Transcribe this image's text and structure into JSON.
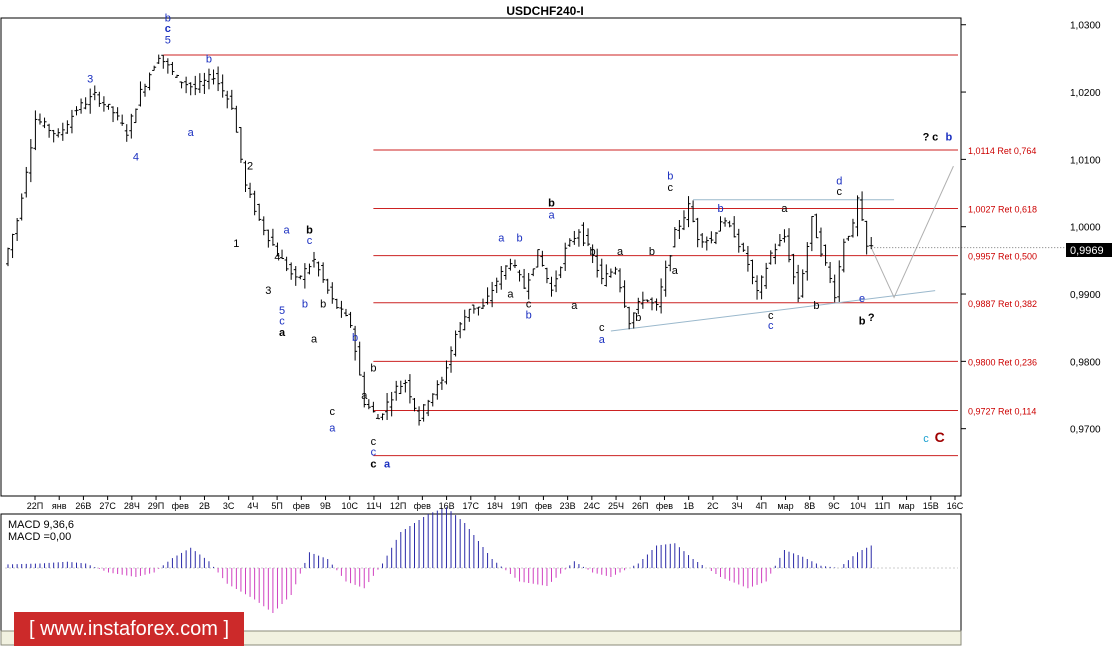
{
  "chart_data": {
    "type": "candlestick",
    "title": "USDCHF240-I",
    "current_price": "0,9969",
    "y_axis": {
      "min": 0.96,
      "max": 1.031,
      "ticks": [
        "1,0300",
        "1,0200",
        "1,0100",
        "1,0000",
        "0,9900",
        "0,9800",
        "0,9700"
      ],
      "tick_values": [
        1.03,
        1.02,
        1.01,
        1.0,
        0.99,
        0.98,
        0.97
      ]
    },
    "x_tick_labels": [
      "22П",
      "янв",
      "26В",
      "27С",
      "28Ч",
      "29П",
      "фев",
      "2В",
      "3С",
      "4Ч",
      "5П",
      "фев",
      "9В",
      "10С",
      "11Ч",
      "12П",
      "фев",
      "16В",
      "17С",
      "18Ч",
      "19П",
      "фев",
      "23В",
      "24С",
      "25Ч",
      "26П",
      "фев",
      "1В",
      "2С",
      "3Ч",
      "4П",
      "мар",
      "8В",
      "9С",
      "10Ч",
      "11П",
      "мар",
      "15В",
      "16С"
    ],
    "price_series_waypoints": [
      [
        0,
        0.9945
      ],
      [
        3,
        1.001
      ],
      [
        7,
        1.016
      ],
      [
        12,
        1.0135
      ],
      [
        16,
        1.0175
      ],
      [
        20,
        1.0195
      ],
      [
        24,
        1.017
      ],
      [
        27,
        1.014
      ],
      [
        30,
        1.02
      ],
      [
        34,
        1.0255
      ],
      [
        38,
        1.022
      ],
      [
        42,
        1.0205
      ],
      [
        46,
        1.0225
      ],
      [
        50,
        1.018
      ],
      [
        53,
        1.006
      ],
      [
        56,
        1.001
      ],
      [
        60,
        0.996
      ],
      [
        64,
        0.992
      ],
      [
        68,
        0.995
      ],
      [
        72,
        0.989
      ],
      [
        76,
        0.9855
      ],
      [
        79,
        0.974
      ],
      [
        82,
        0.9715
      ],
      [
        86,
        0.976
      ],
      [
        88,
        0.977
      ],
      [
        91,
        0.9715
      ],
      [
        93,
        0.9745
      ],
      [
        96,
        0.977
      ],
      [
        99,
        0.984
      ],
      [
        102,
        0.988
      ],
      [
        105,
        0.988
      ],
      [
        108,
        0.992
      ],
      [
        111,
        0.995
      ],
      [
        114,
        0.991
      ],
      [
        117,
        0.996
      ],
      [
        120,
        0.9905
      ],
      [
        123,
        0.9965
      ],
      [
        126,
        0.9995
      ],
      [
        129,
        0.9955
      ],
      [
        131,
        0.992
      ],
      [
        134,
        0.994
      ],
      [
        137,
        0.986
      ],
      [
        140,
        0.9895
      ],
      [
        143,
        0.988
      ],
      [
        147,
        0.999
      ],
      [
        150,
        1.003
      ],
      [
        152,
        0.9985
      ],
      [
        155,
        0.998
      ],
      [
        157,
        1.001
      ],
      [
        160,
        0.999
      ],
      [
        163,
        0.9945
      ],
      [
        165,
        0.99
      ],
      [
        168,
        0.996
      ],
      [
        171,
        0.9985
      ],
      [
        174,
        0.9895
      ],
      [
        177,
        1.001
      ],
      [
        179,
        0.9965
      ],
      [
        182,
        0.99
      ],
      [
        184,
        0.998
      ],
      [
        186,
        1.0
      ],
      [
        187,
        1.004
      ],
      [
        189,
        0.9969
      ]
    ],
    "fib_levels": [
      {
        "value": 1.0255,
        "label": ""
      },
      {
        "value": 1.0114,
        "label": "1,0114 Ret 0,764"
      },
      {
        "value": 1.0027,
        "label": "1,0027 Ret 0,618"
      },
      {
        "value": 0.9957,
        "label": "0,9957 Ret 0,500"
      },
      {
        "value": 0.9887,
        "label": "0,9887 Ret 0,382"
      },
      {
        "value": 0.98,
        "label": "0,9800 Ret 0,236"
      },
      {
        "value": 0.9727,
        "label": "0,9727 Ret 0,114"
      },
      {
        "value": 0.966,
        "label": ""
      }
    ],
    "trendlines": [
      {
        "from": [
          132,
          0.9845
        ],
        "to": [
          203,
          0.9905
        ]
      },
      {
        "from": [
          150,
          1.004
        ],
        "to": [
          194,
          1.004
        ]
      }
    ],
    "projection": [
      [
        189,
        0.9969
      ],
      [
        194,
        0.9895
      ],
      [
        207,
        1.009
      ]
    ],
    "wave_labels": [
      {
        "text": "b",
        "i": 35,
        "v": 1.0305,
        "color": "#1a2fc0",
        "bold": false
      },
      {
        "text": "c",
        "i": 35,
        "v": 1.0289,
        "color": "#1a2fc0",
        "bold": true
      },
      {
        "text": "5",
        "i": 35,
        "v": 1.0272,
        "color": "#1a2fc0",
        "bold": false
      },
      {
        "text": "b",
        "i": 44,
        "v": 1.0244,
        "color": "#1a2fc0",
        "bold": false
      },
      {
        "text": "3",
        "i": 18,
        "v": 1.0214,
        "color": "#1a2fc0",
        "bold": false
      },
      {
        "text": "4",
        "i": 28,
        "v": 1.0098,
        "color": "#1a2fc0",
        "bold": false
      },
      {
        "text": "a",
        "i": 40,
        "v": 1.0135,
        "color": "#1a2fc0",
        "bold": false
      },
      {
        "text": "2",
        "i": 53,
        "v": 1.0085,
        "color": "#000000",
        "bold": false
      },
      {
        "text": "1",
        "i": 50,
        "v": 0.997,
        "color": "#000000",
        "bold": false
      },
      {
        "text": "4",
        "i": 59,
        "v": 0.995,
        "color": "#000000",
        "bold": false
      },
      {
        "text": "3",
        "i": 57,
        "v": 0.99,
        "color": "#000000",
        "bold": false
      },
      {
        "text": "a",
        "i": 61,
        "v": 0.999,
        "color": "#1a2fc0",
        "bold": false
      },
      {
        "text": "b",
        "i": 66,
        "v": 0.999,
        "color": "#000000",
        "bold": true
      },
      {
        "text": "c",
        "i": 66,
        "v": 0.9974,
        "color": "#1a2fc0",
        "bold": false
      },
      {
        "text": "b",
        "i": 65,
        "v": 0.988,
        "color": "#1a2fc0",
        "bold": false
      },
      {
        "text": "5",
        "i": 60,
        "v": 0.987,
        "color": "#1a2fc0",
        "bold": false
      },
      {
        "text": "c",
        "i": 60,
        "v": 0.9855,
        "color": "#1a2fc0",
        "bold": false
      },
      {
        "text": "a",
        "i": 60,
        "v": 0.9838,
        "color": "#000000",
        "bold": true
      },
      {
        "text": "b",
        "i": 69,
        "v": 0.988,
        "color": "#000000",
        "bold": false
      },
      {
        "text": "a",
        "i": 67,
        "v": 0.9828,
        "color": "#000000",
        "bold": false
      },
      {
        "text": "b",
        "i": 76,
        "v": 0.983,
        "color": "#1a2fc0",
        "bold": false
      },
      {
        "text": "c",
        "i": 71,
        "v": 0.972,
        "color": "#000000",
        "bold": false
      },
      {
        "text": "a",
        "i": 71,
        "v": 0.9696,
        "color": "#1a2fc0",
        "bold": false
      },
      {
        "text": "b",
        "i": 80,
        "v": 0.9785,
        "color": "#000000",
        "bold": false
      },
      {
        "text": "a",
        "i": 78,
        "v": 0.9744,
        "color": "#000000",
        "bold": false
      },
      {
        "text": "c",
        "i": 80,
        "v": 0.9676,
        "color": "#000000",
        "bold": false
      },
      {
        "text": "c",
        "i": 80,
        "v": 0.966,
        "color": "#1a2fc0",
        "bold": false
      },
      {
        "text": "c",
        "i": 80,
        "v": 0.9642,
        "color": "#000000",
        "bold": true
      },
      {
        "text": "a",
        "i": 83,
        "v": 0.9642,
        "color": "#1a2fc0",
        "bold": true
      },
      {
        "text": "a",
        "i": 108,
        "v": 0.9978,
        "color": "#1a2fc0",
        "bold": false
      },
      {
        "text": "b",
        "i": 112,
        "v": 0.9978,
        "color": "#1a2fc0",
        "bold": false
      },
      {
        "text": "b",
        "i": 119,
        "v": 1.003,
        "color": "#000000",
        "bold": true
      },
      {
        "text": "a",
        "i": 119,
        "v": 1.0012,
        "color": "#1a2fc0",
        "bold": false
      },
      {
        "text": "b",
        "i": 128,
        "v": 0.9958,
        "color": "#000000",
        "bold": false
      },
      {
        "text": "a",
        "i": 134,
        "v": 0.9958,
        "color": "#000000",
        "bold": false
      },
      {
        "text": "b",
        "i": 141,
        "v": 0.9958,
        "color": "#000000",
        "bold": false
      },
      {
        "text": "a",
        "i": 110,
        "v": 0.9895,
        "color": "#000000",
        "bold": false
      },
      {
        "text": "c",
        "i": 114,
        "v": 0.988,
        "color": "#000000",
        "bold": false
      },
      {
        "text": "b",
        "i": 114,
        "v": 0.9864,
        "color": "#1a2fc0",
        "bold": false
      },
      {
        "text": "a",
        "i": 124,
        "v": 0.9878,
        "color": "#000000",
        "bold": false
      },
      {
        "text": "c",
        "i": 130,
        "v": 0.9845,
        "color": "#000000",
        "bold": false
      },
      {
        "text": "a",
        "i": 130,
        "v": 0.9827,
        "color": "#1a2fc0",
        "bold": false
      },
      {
        "text": "b",
        "i": 138,
        "v": 0.986,
        "color": "#000000",
        "bold": false
      },
      {
        "text": "b",
        "i": 145,
        "v": 1.007,
        "color": "#1a2fc0",
        "bold": false
      },
      {
        "text": "c",
        "i": 145,
        "v": 1.0053,
        "color": "#000000",
        "bold": false
      },
      {
        "text": "a",
        "i": 146,
        "v": 0.993,
        "color": "#000000",
        "bold": false
      },
      {
        "text": "b",
        "i": 156,
        "v": 1.0022,
        "color": "#1a2fc0",
        "bold": false
      },
      {
        "text": "a",
        "i": 170,
        "v": 1.0022,
        "color": "#000000",
        "bold": false
      },
      {
        "text": "c",
        "i": 167,
        "v": 0.9863,
        "color": "#000000",
        "bold": false
      },
      {
        "text": "c",
        "i": 167,
        "v": 0.9848,
        "color": "#1a2fc0",
        "bold": false
      },
      {
        "text": "b",
        "i": 177,
        "v": 0.9878,
        "color": "#000000",
        "bold": false
      },
      {
        "text": "d",
        "i": 182,
        "v": 1.0063,
        "color": "#1a2fc0",
        "bold": false
      },
      {
        "text": "c",
        "i": 182,
        "v": 1.0047,
        "color": "#000000",
        "bold": false
      },
      {
        "text": "e",
        "i": 187,
        "v": 0.9888,
        "color": "#1a2fc0",
        "bold": false
      },
      {
        "text": "b",
        "i": 187,
        "v": 0.9855,
        "color": "#000000",
        "bold": true
      },
      {
        "text": "?",
        "i": 189,
        "v": 0.986,
        "color": "#000000",
        "bold": true
      },
      {
        "text": "?",
        "i": 201,
        "v": 1.0128,
        "color": "#000000",
        "bold": true
      },
      {
        "text": "c",
        "i": 203,
        "v": 1.0128,
        "color": "#000000",
        "bold": true
      },
      {
        "text": "b",
        "i": 206,
        "v": 1.0128,
        "color": "#1a2fc0",
        "bold": true
      },
      {
        "text": "c",
        "i": 201,
        "v": 0.968,
        "color": "#1aa0d0",
        "bold": false
      },
      {
        "text": "C",
        "i": 204,
        "v": 0.968,
        "color": "#a00000",
        "bold": true
      }
    ],
    "macd": {
      "label_main": "MACD 9,36,6",
      "label_sub": "MACD =0,00",
      "waypoints": [
        [
          0,
          0.08
        ],
        [
          7,
          0.1
        ],
        [
          13,
          0.14
        ],
        [
          17,
          0.1
        ],
        [
          22,
          -0.1
        ],
        [
          28,
          -0.2
        ],
        [
          32,
          -0.1
        ],
        [
          36,
          0.22
        ],
        [
          40,
          0.45
        ],
        [
          44,
          0.15
        ],
        [
          48,
          -0.35
        ],
        [
          54,
          -0.7
        ],
        [
          58,
          -1.0
        ],
        [
          62,
          -0.6
        ],
        [
          66,
          0.35
        ],
        [
          70,
          0.2
        ],
        [
          74,
          -0.3
        ],
        [
          78,
          -0.45
        ],
        [
          82,
          0.1
        ],
        [
          86,
          0.8
        ],
        [
          92,
          1.2
        ],
        [
          96,
          1.35
        ],
        [
          100,
          1.0
        ],
        [
          106,
          0.2
        ],
        [
          112,
          -0.3
        ],
        [
          118,
          -0.4
        ],
        [
          124,
          0.15
        ],
        [
          128,
          -0.1
        ],
        [
          132,
          -0.2
        ],
        [
          138,
          0.1
        ],
        [
          142,
          0.5
        ],
        [
          146,
          0.55
        ],
        [
          150,
          0.2
        ],
        [
          156,
          -0.2
        ],
        [
          162,
          -0.45
        ],
        [
          166,
          -0.3
        ],
        [
          170,
          0.4
        ],
        [
          174,
          0.25
        ],
        [
          178,
          0.05
        ],
        [
          182,
          0.0
        ],
        [
          186,
          0.35
        ],
        [
          189,
          0.5
        ]
      ]
    }
  },
  "watermark": "[ www.instaforex.com ]"
}
